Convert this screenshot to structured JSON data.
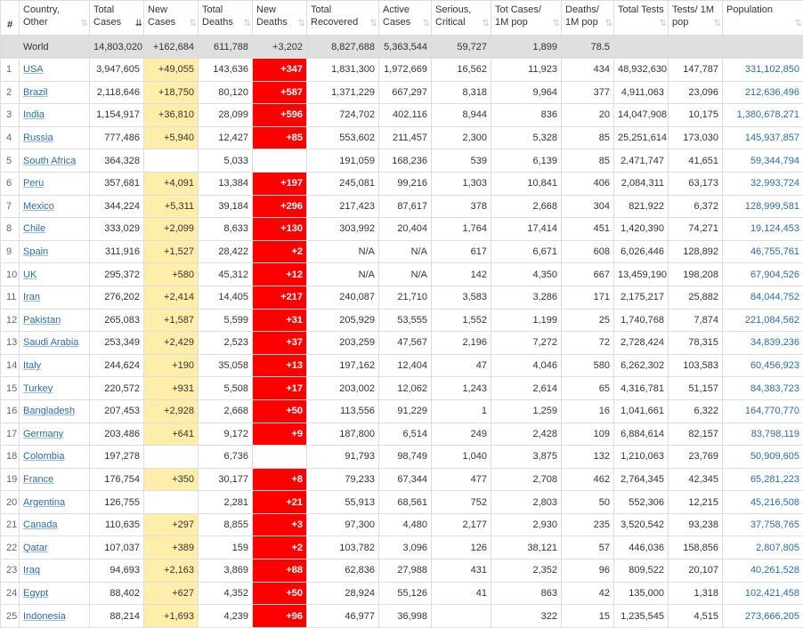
{
  "headers": [
    {
      "id": "num",
      "label": "#"
    },
    {
      "id": "country",
      "label": "Country, Other"
    },
    {
      "id": "total_cases",
      "label": "Total Cases",
      "active": true
    },
    {
      "id": "new_cases",
      "label": "New Cases"
    },
    {
      "id": "total_deaths",
      "label": "Total Deaths"
    },
    {
      "id": "new_deaths",
      "label": "New Deaths"
    },
    {
      "id": "total_recovered",
      "label": "Total Recovered"
    },
    {
      "id": "active_cases",
      "label": "Active Cases"
    },
    {
      "id": "serious",
      "label": "Serious, Critical"
    },
    {
      "id": "cases_per_m",
      "label": "Tot Cases/ 1M pop"
    },
    {
      "id": "deaths_per_m",
      "label": "Deaths/ 1M pop"
    },
    {
      "id": "total_tests",
      "label": "Total Tests"
    },
    {
      "id": "tests_per_m",
      "label": "Tests/ 1M pop"
    },
    {
      "id": "population",
      "label": "Population"
    }
  ],
  "sort_icon": "⇅",
  "sort_icon_active": "⇊",
  "colors": {
    "new_cases_bg": "#ffeeaa",
    "new_deaths_bg": "#ff0000",
    "world_bg": "#dfdfdf",
    "link": "#2b6cb0"
  },
  "world": [
    "",
    "World",
    "14,803,020",
    "+162,684",
    "611,788",
    "+3,202",
    "8,827,688",
    "5,363,544",
    "59,727",
    "1,899",
    "78.5",
    "",
    "",
    ""
  ],
  "rows": [
    [
      "1",
      "USA",
      "3,947,605",
      "+49,055",
      "143,636",
      "+347",
      "1,831,300",
      "1,972,669",
      "16,562",
      "11,923",
      "434",
      "48,932,630",
      "147,787",
      "331,102,850"
    ],
    [
      "2",
      "Brazil",
      "2,118,646",
      "+18,750",
      "80,120",
      "+587",
      "1,371,229",
      "667,297",
      "8,318",
      "9,964",
      "377",
      "4,911,063",
      "23,096",
      "212,636,496"
    ],
    [
      "3",
      "India",
      "1,154,917",
      "+36,810",
      "28,099",
      "+596",
      "724,702",
      "402,116",
      "8,944",
      "836",
      "20",
      "14,047,908",
      "10,175",
      "1,380,678,271"
    ],
    [
      "4",
      "Russia",
      "777,486",
      "+5,940",
      "12,427",
      "+85",
      "553,602",
      "211,457",
      "2,300",
      "5,328",
      "85",
      "25,251,614",
      "173,030",
      "145,937,857"
    ],
    [
      "5",
      "South Africa",
      "364,328",
      "",
      "5,033",
      "",
      "191,059",
      "168,236",
      "539",
      "6,139",
      "85",
      "2,471,747",
      "41,651",
      "59,344,794"
    ],
    [
      "6",
      "Peru",
      "357,681",
      "+4,091",
      "13,384",
      "+197",
      "245,081",
      "99,216",
      "1,303",
      "10,841",
      "406",
      "2,084,311",
      "63,173",
      "32,993,724"
    ],
    [
      "7",
      "Mexico",
      "344,224",
      "+5,311",
      "39,184",
      "+296",
      "217,423",
      "87,617",
      "378",
      "2,668",
      "304",
      "821,922",
      "6,372",
      "128,999,581"
    ],
    [
      "8",
      "Chile",
      "333,029",
      "+2,099",
      "8,633",
      "+130",
      "303,992",
      "20,404",
      "1,764",
      "17,414",
      "451",
      "1,420,390",
      "74,271",
      "19,124,453"
    ],
    [
      "9",
      "Spain",
      "311,916",
      "+1,527",
      "28,422",
      "+2",
      "N/A",
      "N/A",
      "617",
      "6,671",
      "608",
      "6,026,446",
      "128,892",
      "46,755,761"
    ],
    [
      "10",
      "UK",
      "295,372",
      "+580",
      "45,312",
      "+12",
      "N/A",
      "N/A",
      "142",
      "4,350",
      "667",
      "13,459,190",
      "198,208",
      "67,904,526"
    ],
    [
      "11",
      "Iran",
      "276,202",
      "+2,414",
      "14,405",
      "+217",
      "240,087",
      "21,710",
      "3,583",
      "3,286",
      "171",
      "2,175,217",
      "25,882",
      "84,044,752"
    ],
    [
      "12",
      "Pakistan",
      "265,083",
      "+1,587",
      "5,599",
      "+31",
      "205,929",
      "53,555",
      "1,552",
      "1,199",
      "25",
      "1,740,768",
      "7,874",
      "221,084,562"
    ],
    [
      "13",
      "Saudi Arabia",
      "253,349",
      "+2,429",
      "2,523",
      "+37",
      "203,259",
      "47,567",
      "2,196",
      "7,272",
      "72",
      "2,728,424",
      "78,315",
      "34,839,236"
    ],
    [
      "14",
      "Italy",
      "244,624",
      "+190",
      "35,058",
      "+13",
      "197,162",
      "12,404",
      "47",
      "4,046",
      "580",
      "6,262,302",
      "103,583",
      "60,456,923"
    ],
    [
      "15",
      "Turkey",
      "220,572",
      "+931",
      "5,508",
      "+17",
      "203,002",
      "12,062",
      "1,243",
      "2,614",
      "65",
      "4,316,781",
      "51,157",
      "84,383,723"
    ],
    [
      "16",
      "Bangladesh",
      "207,453",
      "+2,928",
      "2,668",
      "+50",
      "113,556",
      "91,229",
      "1",
      "1,259",
      "16",
      "1,041,661",
      "6,322",
      "164,770,770"
    ],
    [
      "17",
      "Germany",
      "203,486",
      "+641",
      "9,172",
      "+9",
      "187,800",
      "6,514",
      "249",
      "2,428",
      "109",
      "6,884,614",
      "82,157",
      "83,798,119"
    ],
    [
      "18",
      "Colombia",
      "197,278",
      "",
      "6,736",
      "",
      "91,793",
      "98,749",
      "1,040",
      "3,875",
      "132",
      "1,210,063",
      "23,769",
      "50,909,605"
    ],
    [
      "19",
      "France",
      "176,754",
      "+350",
      "30,177",
      "+8",
      "79,233",
      "67,344",
      "477",
      "2,708",
      "462",
      "2,764,345",
      "42,345",
      "65,281,223"
    ],
    [
      "20",
      "Argentina",
      "126,755",
      "",
      "2,281",
      "+21",
      "55,913",
      "68,561",
      "752",
      "2,803",
      "50",
      "552,306",
      "12,215",
      "45,216,508"
    ],
    [
      "21",
      "Canada",
      "110,635",
      "+297",
      "8,855",
      "+3",
      "97,300",
      "4,480",
      "2,177",
      "2,930",
      "235",
      "3,520,542",
      "93,238",
      "37,758,765"
    ],
    [
      "22",
      "Qatar",
      "107,037",
      "+389",
      "159",
      "+2",
      "103,782",
      "3,096",
      "126",
      "38,121",
      "57",
      "446,036",
      "158,856",
      "2,807,805"
    ],
    [
      "23",
      "Iraq",
      "94,693",
      "+2,163",
      "3,869",
      "+88",
      "62,836",
      "27,988",
      "431",
      "2,352",
      "96",
      "809,522",
      "20,107",
      "40,261,528"
    ],
    [
      "24",
      "Egypt",
      "88,402",
      "+627",
      "4,352",
      "+50",
      "28,924",
      "55,126",
      "41",
      "863",
      "42",
      "135,000",
      "1,318",
      "102,421,458"
    ],
    [
      "25",
      "Indonesia",
      "88,214",
      "+1,693",
      "4,239",
      "+96",
      "46,977",
      "36,998",
      "",
      "322",
      "15",
      "1,235,545",
      "4,515",
      "273,666,205"
    ]
  ]
}
